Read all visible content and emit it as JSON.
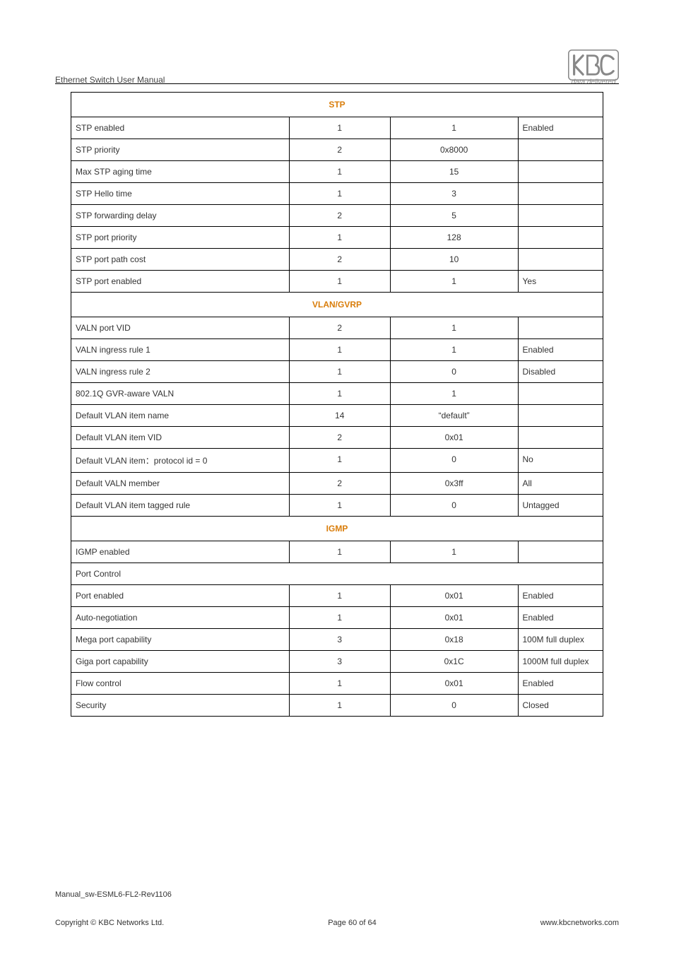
{
  "header": {
    "title": "Ethernet Switch User Manual",
    "tagline": "data delivered"
  },
  "sections": {
    "stp": {
      "heading": "STP",
      "rows": [
        {
          "label": "STP enabled",
          "a": "1",
          "b": "1",
          "c": "Enabled"
        },
        {
          "label": "STP priority",
          "a": "2",
          "b": "0x8000",
          "c": ""
        },
        {
          "label": "Max STP aging time",
          "a": "1",
          "b": "15",
          "c": ""
        },
        {
          "label": "STP Hello time",
          "a": "1",
          "b": "3",
          "c": ""
        },
        {
          "label": "STP forwarding delay",
          "a": "2",
          "b": "5",
          "c": ""
        },
        {
          "label": "STP port priority",
          "a": "1",
          "b": "128",
          "c": ""
        },
        {
          "label": "STP port path cost",
          "a": "2",
          "b": "10",
          "c": ""
        },
        {
          "label": "STP port enabled",
          "a": "1",
          "b": "1",
          "c": "Yes"
        }
      ]
    },
    "vlan": {
      "heading": "VLAN/GVRP",
      "rows": [
        {
          "label": "VALN port VID",
          "a": "2",
          "b": "1",
          "c": ""
        },
        {
          "label": "VALN ingress rule 1",
          "a": "1",
          "b": "1",
          "c": "Enabled"
        },
        {
          "label": "VALN ingress rule 2",
          "a": "1",
          "b": "0",
          "c": "Disabled"
        },
        {
          "label": "802.1Q GVR-aware VALN",
          "a": "1",
          "b": "1",
          "c": ""
        },
        {
          "label": "Default VLAN item name",
          "a": "14",
          "b": "“default”",
          "c": ""
        },
        {
          "label": "Default VLAN item VID",
          "a": "2",
          "b": "0x01",
          "c": ""
        },
        {
          "label": "Default VLAN item：protocol id = 0",
          "a": "1",
          "b": "0",
          "c": "No"
        },
        {
          "label": "Default VALN member",
          "a": "2",
          "b": "0x3ff",
          "c": "All"
        },
        {
          "label": "Default VLAN item tagged rule",
          "a": "1",
          "b": "0",
          "c": "Untagged"
        }
      ]
    },
    "igmp": {
      "heading": "IGMP",
      "rows": [
        {
          "label": "IGMP enabled",
          "a": "1",
          "b": "1",
          "c": ""
        }
      ]
    },
    "port": {
      "heading": "Port Control",
      "rows": [
        {
          "label": "Port enabled",
          "a": "1",
          "b": "0x01",
          "c": "Enabled"
        },
        {
          "label": "Auto-negotiation",
          "a": "1",
          "b": "0x01",
          "c": "Enabled"
        },
        {
          "label": "Mega port capability",
          "a": "3",
          "b": "0x18",
          "c": "100M full duplex"
        },
        {
          "label": "Giga port capability",
          "a": "3",
          "b": "0x1C",
          "c": "1000M full duplex"
        },
        {
          "label": "Flow control",
          "a": "1",
          "b": "0x01",
          "c": "Enabled"
        },
        {
          "label": "Security",
          "a": "1",
          "b": "0",
          "c": "Closed"
        }
      ]
    }
  },
  "footer": {
    "docid": "Manual_sw-ESML6-FL2-Rev1106",
    "copyright": "Copyright © KBC Networks Ltd.",
    "page": "Page 60 of 64",
    "site": "www.kbcnetworks.com"
  }
}
